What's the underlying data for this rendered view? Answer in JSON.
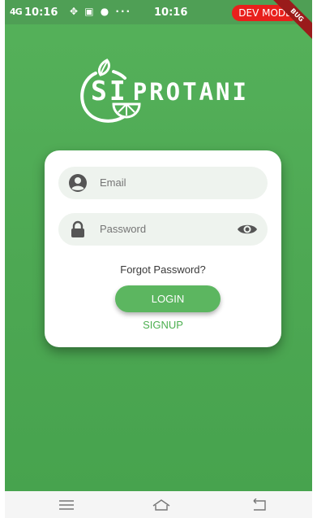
{
  "status_bar": {
    "signal": "4G",
    "time_left": "10:16",
    "icons": "✥ ▣ ● ···",
    "time_center": "10:16",
    "dev_badge": "DEV MODE",
    "debug_ribbon": "BUG"
  },
  "logo": {
    "si": "SI",
    "rest": "PROTANI"
  },
  "login_form": {
    "email_placeholder": "Email",
    "password_placeholder": "Password",
    "forgot_password": "Forgot Password?",
    "login_label": "LOGIN",
    "signup_label": "SIGNUP"
  },
  "colors": {
    "primary_green": "#4caf50",
    "dev_badge_red": "#e8201c",
    "field_background": "#eef3ee"
  },
  "icons": {
    "email": "person-icon",
    "password": "lock-icon",
    "visibility": "eye-icon",
    "nav_menu": "menu-icon",
    "nav_home": "home-icon",
    "nav_back": "back-icon"
  }
}
